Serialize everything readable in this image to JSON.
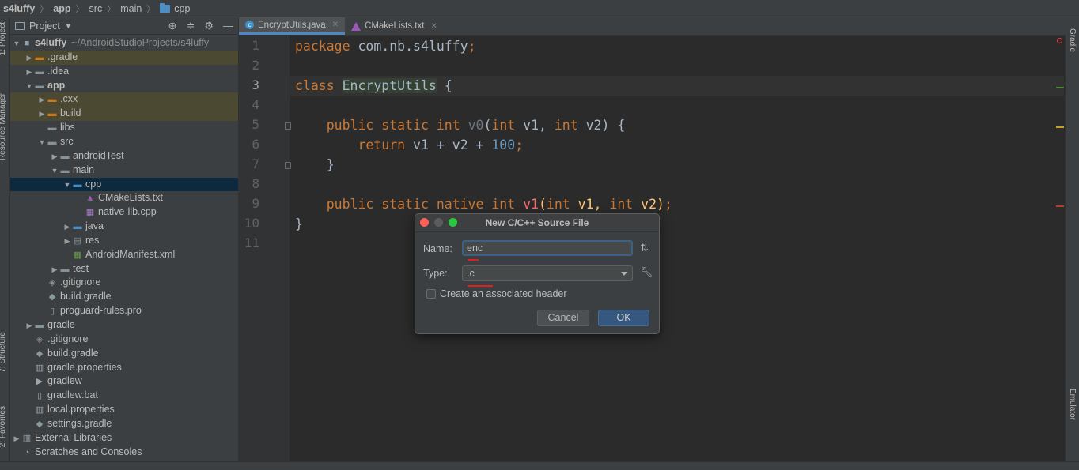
{
  "breadcrumb": [
    "s4luffy",
    "app",
    "src",
    "main",
    "cpp"
  ],
  "left_tool_tabs": [
    "1: Project",
    "Resource Manager",
    "7: Structure",
    "2: Favorites"
  ],
  "right_tool_tabs": [
    "Gradle",
    "Emulator"
  ],
  "project_panel": {
    "title": "Project",
    "tree": [
      {
        "label": "s4luffy",
        "suffix": "~/AndroidStudioProjects/s4luffy",
        "depth": 0,
        "arrow": "down",
        "icon": "module-icon",
        "bold": true
      },
      {
        "label": ".gradle",
        "depth": 1,
        "arrow": "right",
        "icon": "folder-orange-icon",
        "highlight": "olive"
      },
      {
        "label": ".idea",
        "depth": 1,
        "arrow": "right",
        "icon": "folder-icon"
      },
      {
        "label": "app",
        "depth": 1,
        "arrow": "down",
        "icon": "folder-icon",
        "bold": true
      },
      {
        "label": ".cxx",
        "depth": 2,
        "arrow": "right",
        "icon": "folder-orange-icon",
        "highlight": "olive"
      },
      {
        "label": "build",
        "depth": 2,
        "arrow": "right",
        "icon": "folder-orange-icon",
        "highlight": "olive"
      },
      {
        "label": "libs",
        "depth": 2,
        "arrow": "none",
        "icon": "folder-icon"
      },
      {
        "label": "src",
        "depth": 2,
        "arrow": "down",
        "icon": "folder-icon"
      },
      {
        "label": "androidTest",
        "depth": 3,
        "arrow": "right",
        "icon": "folder-icon"
      },
      {
        "label": "main",
        "depth": 3,
        "arrow": "down",
        "icon": "folder-icon"
      },
      {
        "label": "cpp",
        "depth": 4,
        "arrow": "down",
        "icon": "folder-blue-icon",
        "highlight": "selected"
      },
      {
        "label": "CMakeLists.txt",
        "depth": 5,
        "arrow": "none",
        "icon": "cmake-icon"
      },
      {
        "label": "native-lib.cpp",
        "depth": 5,
        "arrow": "none",
        "icon": "cpp-file-icon"
      },
      {
        "label": "java",
        "depth": 4,
        "arrow": "right",
        "icon": "folder-blue-icon"
      },
      {
        "label": "res",
        "depth": 4,
        "arrow": "right",
        "icon": "res-folder-icon"
      },
      {
        "label": "AndroidManifest.xml",
        "depth": 4,
        "arrow": "none",
        "icon": "manifest-icon"
      },
      {
        "label": "test",
        "depth": 3,
        "arrow": "right",
        "icon": "folder-icon"
      },
      {
        "label": ".gitignore",
        "depth": 2,
        "arrow": "none",
        "icon": "gitignore-icon"
      },
      {
        "label": "build.gradle",
        "depth": 2,
        "arrow": "none",
        "icon": "gradle-icon"
      },
      {
        "label": "proguard-rules.pro",
        "depth": 2,
        "arrow": "none",
        "icon": "file-icon"
      },
      {
        "label": "gradle",
        "depth": 1,
        "arrow": "right",
        "icon": "folder-icon"
      },
      {
        "label": ".gitignore",
        "depth": 1,
        "arrow": "none",
        "icon": "gitignore-icon"
      },
      {
        "label": "build.gradle",
        "depth": 1,
        "arrow": "none",
        "icon": "gradle-icon"
      },
      {
        "label": "gradle.properties",
        "depth": 1,
        "arrow": "none",
        "icon": "properties-icon"
      },
      {
        "label": "gradlew",
        "depth": 1,
        "arrow": "none",
        "icon": "exec-file-icon"
      },
      {
        "label": "gradlew.bat",
        "depth": 1,
        "arrow": "none",
        "icon": "file-icon"
      },
      {
        "label": "local.properties",
        "depth": 1,
        "arrow": "none",
        "icon": "properties-icon"
      },
      {
        "label": "settings.gradle",
        "depth": 1,
        "arrow": "none",
        "icon": "gradle-icon"
      },
      {
        "label": "External Libraries",
        "depth": 0,
        "arrow": "right",
        "icon": "libraries-icon"
      },
      {
        "label": "Scratches and Consoles",
        "depth": 0,
        "arrow": "none",
        "icon": "scratches-icon"
      }
    ]
  },
  "editor_tabs": [
    {
      "label": "EncryptUtils.java",
      "active": true,
      "icon": "java-class-icon"
    },
    {
      "label": "CMakeLists.txt",
      "active": false,
      "icon": "cmake-icon"
    }
  ],
  "line_numbers": [
    "1",
    "2",
    "3",
    "4",
    "5",
    "6",
    "7",
    "8",
    "9",
    "10",
    "11"
  ],
  "current_line": "3",
  "code": {
    "l1_kw": "package",
    "l1_rest": " com.nb.s4luffy",
    "l1_semi": ";",
    "l3_kw": "class",
    "l3_name": "EncryptUtils",
    "l3_rest": " {",
    "l5_kw": "public static int",
    "l5_fn": "v0",
    "l5_p1": "(",
    "l5_int1": "int",
    "l5_a": " v1, ",
    "l5_int2": "int",
    "l5_b": " v2) {",
    "l6_kw": "return",
    "l6_expr": " v1 + v2 + ",
    "l6_num": "100",
    "l6_semi": ";",
    "l7": "}",
    "l9_kw": "public static native int",
    "l9_fn": "v1",
    "l9_p1": "(",
    "l9_int1": "int",
    "l9_a": " v1, ",
    "l9_int2": "int",
    "l9_b": " v2)",
    "l9_semi": ";",
    "l10": "}"
  },
  "dialog": {
    "title": "New C/C++ Source File",
    "name_label": "Name:",
    "name_value": "enc",
    "type_label": "Type:",
    "type_value": ".c",
    "checkbox_label": "Create an associated header",
    "checkbox_checked": false,
    "cancel_label": "Cancel",
    "ok_label": "OK"
  },
  "colors": {
    "keyword": "#cc7832",
    "function_decl": "#ffc66d",
    "number": "#6897bb",
    "native_fn": "#ff6b68",
    "accent": "#365880"
  }
}
